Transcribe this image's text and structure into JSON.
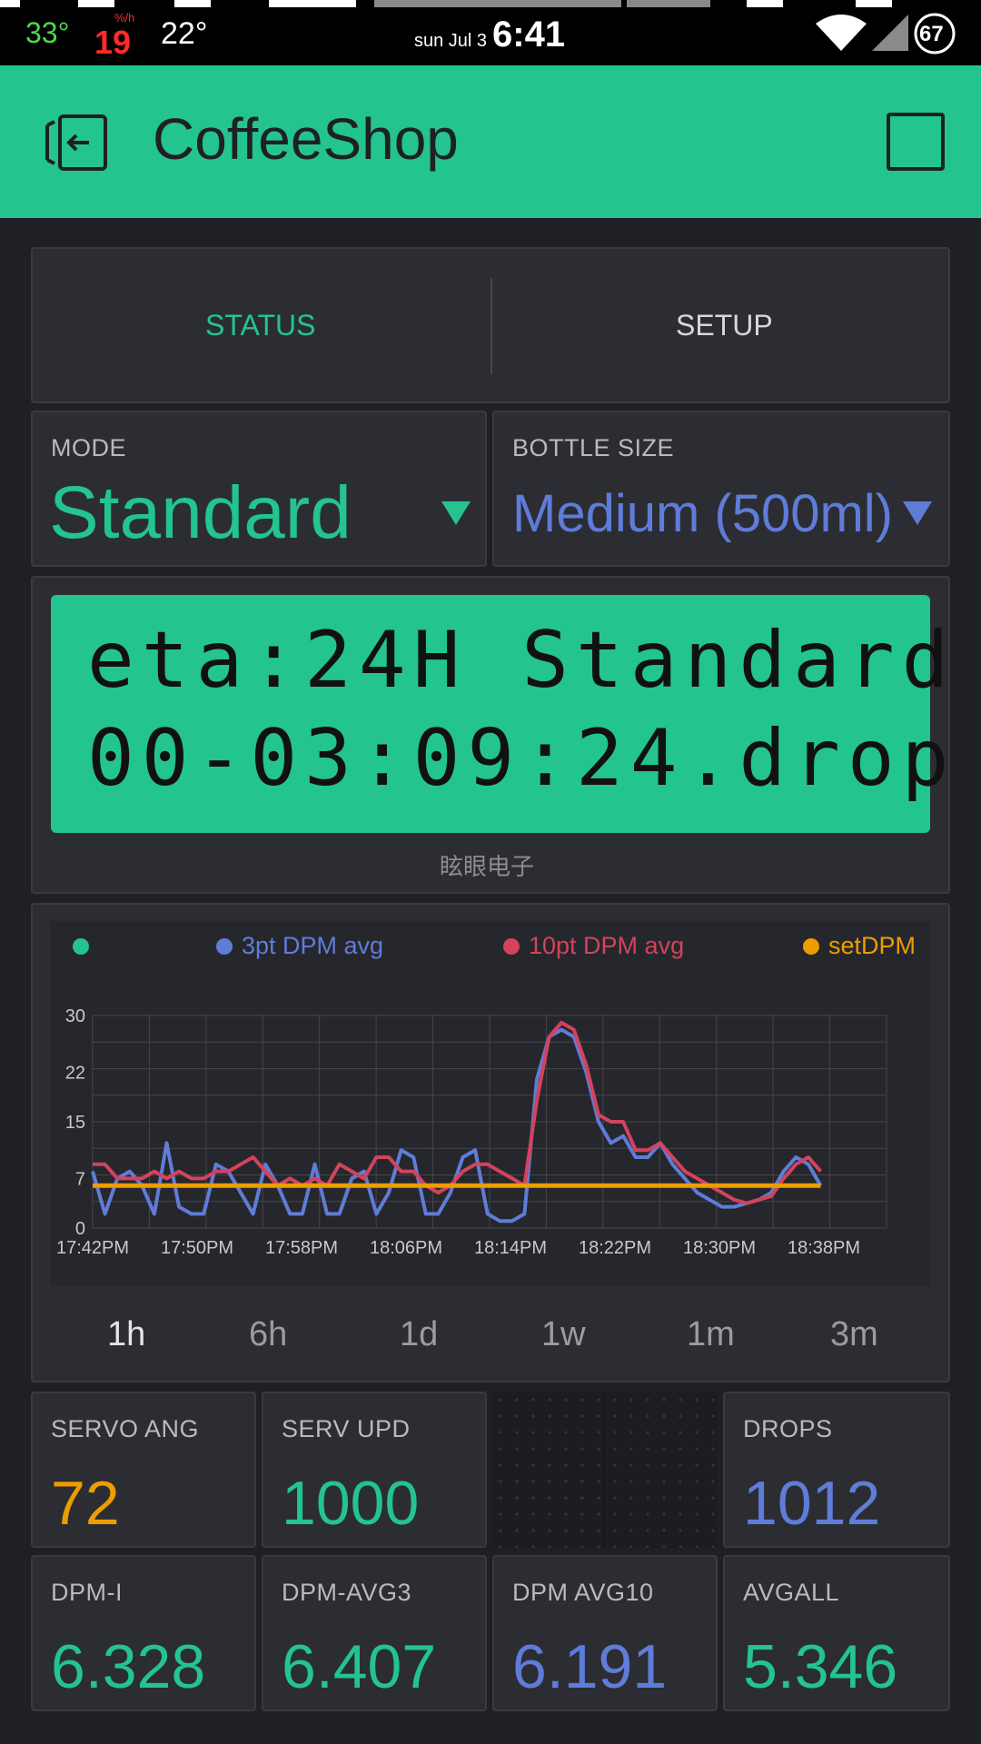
{
  "status_bar": {
    "temp1": "33°",
    "rate_value": "19",
    "rate_unit": "%/h",
    "temp2": "22°",
    "date": "sun Jul 3",
    "time": "6:41",
    "battery": "67"
  },
  "header": {
    "title": "CoffeeShop",
    "color": "#23c48e"
  },
  "tabs": [
    {
      "label": "STATUS",
      "active": true
    },
    {
      "label": "SETUP",
      "active": false
    }
  ],
  "mode": {
    "label": "MODE",
    "value": "Standard"
  },
  "bottle": {
    "label": "BOTTLE SIZE",
    "value": "Medium (500ml)"
  },
  "lcd": {
    "line1": "eta:24H Standard",
    "line2": "00-03:09:24.drop",
    "caption": "眩眼电子"
  },
  "chart_legend": [
    {
      "name": "",
      "color": "#23c48e"
    },
    {
      "name": "3pt DPM avg",
      "color": "#5f7cd8"
    },
    {
      "name": "10pt DPM avg",
      "color": "#d3435c"
    },
    {
      "name": "setDPM",
      "color": "#ed9d00"
    }
  ],
  "chart_data": {
    "type": "line",
    "x_ticks": [
      "17:42PM",
      "17:50PM",
      "17:58PM",
      "18:06PM",
      "18:14PM",
      "18:22PM",
      "18:30PM",
      "18:38PM"
    ],
    "y_ticks": [
      "0",
      "7",
      "15",
      "22",
      "30"
    ],
    "ylim": [
      0,
      30
    ],
    "grid": true,
    "legend_position": "top",
    "series": [
      {
        "name": "3pt DPM avg",
        "color": "#5f7cd8",
        "values": [
          8,
          2,
          7,
          8,
          6,
          2,
          12,
          3,
          2,
          2,
          9,
          8,
          5,
          2,
          9,
          6,
          2,
          2,
          9,
          2,
          2,
          7,
          8,
          2,
          5,
          11,
          10,
          2,
          2,
          5,
          10,
          11,
          2,
          1,
          1,
          2,
          21,
          27,
          28,
          27,
          22,
          15,
          12,
          13,
          10,
          10,
          12,
          9,
          7,
          5,
          4,
          3,
          3,
          3.5,
          4,
          5,
          8,
          10,
          9,
          6
        ]
      },
      {
        "name": "10pt DPM avg",
        "color": "#d3435c",
        "values": [
          9,
          9,
          7,
          7,
          7,
          8,
          7,
          8,
          7,
          7,
          8,
          8,
          9,
          10,
          8,
          6,
          7,
          6,
          7,
          6,
          9,
          8,
          7,
          10,
          10,
          8,
          8,
          6,
          5,
          6,
          8,
          9,
          9,
          8,
          7,
          6,
          18,
          27,
          29,
          28,
          23,
          16,
          15,
          15,
          11,
          11,
          12,
          10,
          8,
          7,
          6,
          5,
          4,
          3.5,
          4,
          4.5,
          7,
          9,
          10,
          8
        ]
      },
      {
        "name": "setDPM",
        "color": "#ed9d00",
        "values": [
          6,
          6
        ]
      }
    ]
  },
  "time_ranges": [
    "1h",
    "6h",
    "1d",
    "1w",
    "1m",
    "3m"
  ],
  "active_range": "1h",
  "values_row1": [
    {
      "label": "SERVO ANG",
      "value": "72",
      "color": "#ed9d00"
    },
    {
      "label": "SERV UPD",
      "value": "1000",
      "color": "#23c48e"
    },
    {
      "label": "DROPS",
      "value": "1012",
      "color": "#5f7cd8"
    }
  ],
  "values_row2": [
    {
      "label": "DPM-I",
      "value": "6.328",
      "color": "#23c48e"
    },
    {
      "label": "DPM-AVG3",
      "value": "6.407",
      "color": "#23c48e"
    },
    {
      "label": "DPM AVG10",
      "value": "6.191",
      "color": "#5f7cd8"
    },
    {
      "label": "AVGALL",
      "value": "5.346",
      "color": "#23c48e"
    }
  ]
}
